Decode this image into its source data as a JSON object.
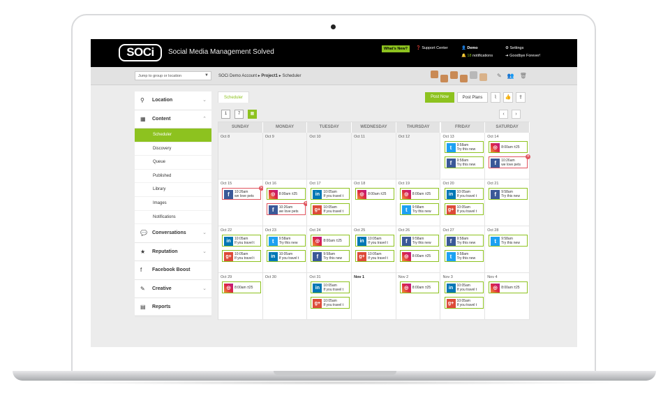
{
  "app": {
    "logo": "SOCi",
    "tagline": "Social Media Management Solved"
  },
  "topbar": {
    "whats_new": "What's New?",
    "support": "Support Center",
    "user": "Demo",
    "notifications_count": "18",
    "notifications_label": "notifications",
    "settings": "Settings",
    "goodbye": "Goodbye Forever!"
  },
  "subbar": {
    "jump_placeholder": "Jump to group or location",
    "breadcrumb_account": "SOCi Demo Account",
    "breadcrumb_project": "Project1",
    "breadcrumb_page": "Scheduler"
  },
  "sidebar": {
    "location": "Location",
    "content": "Content",
    "sub": [
      "Scheduler",
      "Discovery",
      "Queue",
      "Published",
      "Library",
      "Images",
      "Notifications"
    ],
    "conversations": "Conversations",
    "reputation": "Reputation",
    "facebook_boost": "Facebook Boost",
    "creative": "Creative",
    "reports": "Reports"
  },
  "main": {
    "tab": "Scheduler",
    "post_now": "Post Now",
    "post_plans": "Post Plans"
  },
  "calendar": {
    "days": [
      "SUNDAY",
      "MONDAY",
      "TUESDAY",
      "WEDNESDAY",
      "THURSDAY",
      "FRIDAY",
      "SATURDAY"
    ],
    "weeks": [
      [
        {
          "date": "Oct 8",
          "past": true,
          "posts": []
        },
        {
          "date": "Oct 9",
          "past": true,
          "posts": []
        },
        {
          "date": "Oct 10",
          "past": true,
          "posts": []
        },
        {
          "date": "Oct 11",
          "past": true,
          "posts": []
        },
        {
          "date": "Oct 12",
          "past": true,
          "posts": []
        },
        {
          "date": "Oct 13",
          "posts": [
            {
              "net": "twitter",
              "l1": "9:58am",
              "l2": "Try this new"
            },
            {
              "net": "facebook",
              "l1": "9:58am",
              "l2": "Try this new"
            }
          ]
        },
        {
          "date": "Oct 14",
          "posts": [
            {
              "net": "instagram",
              "l1": "8:00am ±25",
              "l2": ""
            },
            {
              "net": "facebook",
              "l1": "10:26am",
              "l2": "we love pets",
              "err": true
            }
          ]
        }
      ],
      [
        {
          "date": "Oct 15",
          "posts": [
            {
              "net": "facebook",
              "l1": "10:26am",
              "l2": "we love pets",
              "err": true
            }
          ]
        },
        {
          "date": "Oct 16",
          "posts": [
            {
              "net": "instagram",
              "l1": "8:00am ±25",
              "l2": ""
            },
            {
              "net": "facebook",
              "l1": "10:26am",
              "l2": "we love pets",
              "err": true
            }
          ]
        },
        {
          "date": "Oct 17",
          "posts": [
            {
              "net": "linkedin",
              "l1": "10:05am",
              "l2": "If you travel t"
            },
            {
              "net": "google",
              "l1": "10:05am",
              "l2": "If you travel t"
            }
          ]
        },
        {
          "date": "Oct 18",
          "posts": [
            {
              "net": "instagram",
              "l1": "8:00am ±25",
              "l2": ""
            }
          ]
        },
        {
          "date": "Oct 19",
          "posts": [
            {
              "net": "instagram",
              "l1": "8:00am ±25",
              "l2": ""
            },
            {
              "net": "twitter",
              "l1": "9:58am",
              "l2": "Try this new"
            }
          ]
        },
        {
          "date": "Oct 20",
          "posts": [
            {
              "net": "linkedin",
              "l1": "10:05am",
              "l2": "If you travel t"
            },
            {
              "net": "google",
              "l1": "10:05am",
              "l2": "If you travel t"
            }
          ]
        },
        {
          "date": "Oct 21",
          "posts": [
            {
              "net": "facebook",
              "l1": "9:58am",
              "l2": "Try this new"
            }
          ]
        }
      ],
      [
        {
          "date": "Oct 22",
          "posts": [
            {
              "net": "linkedin",
              "l1": "10:05am",
              "l2": "If you travel t"
            },
            {
              "net": "google",
              "l1": "10:05am",
              "l2": "If you travel t"
            }
          ]
        },
        {
          "date": "Oct 23",
          "posts": [
            {
              "net": "twitter",
              "l1": "9:58am",
              "l2": "Try this new"
            },
            {
              "net": "linkedin",
              "l1": "10:05am",
              "l2": "If you travel t"
            }
          ]
        },
        {
          "date": "Oct 24",
          "posts": [
            {
              "net": "instagram",
              "l1": "8:00am ±25",
              "l2": ""
            },
            {
              "net": "facebook",
              "l1": "9:58am",
              "l2": "Try this new"
            }
          ]
        },
        {
          "date": "Oct 25",
          "posts": [
            {
              "net": "linkedin",
              "l1": "10:05am",
              "l2": "If you travel t"
            },
            {
              "net": "google",
              "l1": "10:05am",
              "l2": "If you travel t"
            }
          ]
        },
        {
          "date": "Oct 26",
          "posts": [
            {
              "net": "facebook",
              "l1": "9:58am",
              "l2": "Try this new"
            },
            {
              "net": "instagram",
              "l1": "8:00am ±25",
              "l2": ""
            }
          ]
        },
        {
          "date": "Oct 27",
          "posts": [
            {
              "net": "facebook",
              "l1": "9:58am",
              "l2": "Try this new"
            },
            {
              "net": "twitter",
              "l1": "9:58am",
              "l2": "Try this new"
            }
          ]
        },
        {
          "date": "Oct 28",
          "posts": [
            {
              "net": "twitter",
              "l1": "9:58am",
              "l2": "Try this new"
            }
          ]
        }
      ],
      [
        {
          "date": "Oct 29",
          "posts": [
            {
              "net": "instagram",
              "l1": "8:00am ±25",
              "l2": ""
            }
          ]
        },
        {
          "date": "Oct 30",
          "posts": []
        },
        {
          "date": "Oct 31",
          "posts": [
            {
              "net": "linkedin",
              "l1": "10:05am",
              "l2": "If you travel t"
            },
            {
              "net": "google",
              "l1": "10:05am",
              "l2": "If you travel t"
            }
          ]
        },
        {
          "date": "Nov 1",
          "bold": true,
          "posts": []
        },
        {
          "date": "Nov 2",
          "posts": [
            {
              "net": "instagram",
              "l1": "8:00am ±25",
              "l2": ""
            }
          ]
        },
        {
          "date": "Nov 3",
          "posts": [
            {
              "net": "linkedin",
              "l1": "10:05am",
              "l2": "If you travel t"
            },
            {
              "net": "google",
              "l1": "10:05am",
              "l2": "If you travel t"
            }
          ]
        },
        {
          "date": "Nov 4",
          "posts": [
            {
              "net": "instagram",
              "l1": "8:00am ±25",
              "l2": ""
            }
          ]
        }
      ]
    ]
  },
  "colors": {
    "accent": "#8dc21f",
    "error": "#e0545e",
    "topbar": "#000000"
  }
}
